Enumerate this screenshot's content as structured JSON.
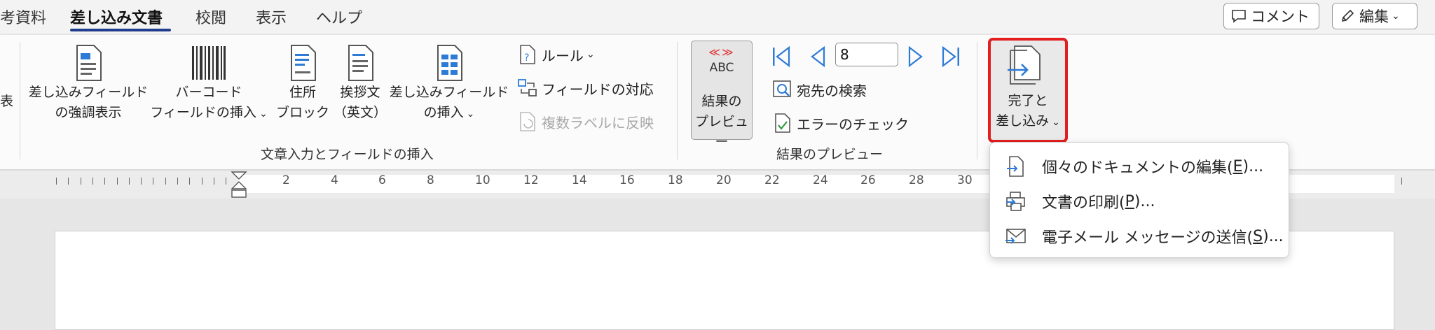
{
  "tabs": [
    {
      "label": "考資料"
    },
    {
      "label": "差し込み文書"
    },
    {
      "label": "校閲"
    },
    {
      "label": "表示"
    },
    {
      "label": "ヘルプ"
    }
  ],
  "top_buttons": {
    "comment": "コメント",
    "edit": "編集"
  },
  "ribbon": {
    "left_fragment": "表",
    "highlight_fields": [
      "差し込みフィールド",
      "の強調表示"
    ],
    "barcode": [
      "バーコード",
      "フィールドの挿入"
    ],
    "address_block": [
      "住所",
      "ブロック"
    ],
    "greeting": [
      "挨拶文",
      "（英文）"
    ],
    "insert_field": [
      "差し込みフィールド",
      "の挿入"
    ],
    "rules": "ルール",
    "match_fields": "フィールドの対応",
    "update_labels": "複数ラベルに反映",
    "group_write_insert": "文章入力とフィールドの挿入",
    "preview_icon_text": "ABC",
    "preview_icon_marks": "≪≫",
    "preview_results": [
      "結果の",
      "プレビュー"
    ],
    "record_value": "8",
    "find_recipient": "宛先の検索",
    "check_errors": "エラーのチェック",
    "group_preview": "結果のプレビュー",
    "finish_merge": [
      "完了と",
      "差し込み"
    ]
  },
  "ruler": {
    "labels": [
      "2",
      "4",
      "6",
      "8",
      "10",
      "12",
      "14",
      "16",
      "18",
      "20",
      "22",
      "24",
      "26",
      "28",
      "30"
    ]
  },
  "menu": {
    "items": [
      {
        "text": "個々のドキュメントの編集(",
        "key": "E",
        "suffix": ")..."
      },
      {
        "text": "文書の印刷(",
        "key": "P",
        "suffix": ")..."
      },
      {
        "text": "電子メール メッセージの送信(",
        "key": "S",
        "suffix": ")..."
      }
    ]
  },
  "colors": {
    "accent": "#1f3d8c",
    "highlight": "#e21e1e",
    "icon_blue": "#2e7bd6"
  }
}
